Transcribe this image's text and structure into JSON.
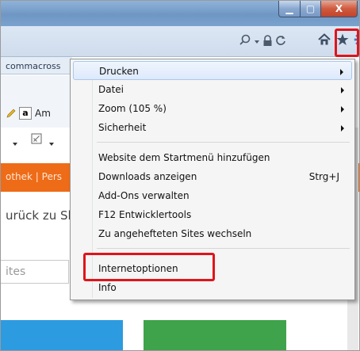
{
  "window": {
    "minimize_label": "▁",
    "maximize_label": "▢",
    "close_label": "X"
  },
  "toolbar": {
    "search_dropdown_icon": "search-icon",
    "lock_icon": "lock-icon",
    "refresh_icon": "refresh-icon",
    "home_icon": "home-icon",
    "favorites_icon": "star-icon",
    "tools_icon": "gear-icon"
  },
  "background": {
    "favorites_text": "commacross",
    "amazon_label": "Am",
    "orange_bar_text": "othek | Pers",
    "body_text": "urück zu Sl",
    "search_placeholder": "ites"
  },
  "menu": {
    "items": [
      {
        "label": "Drucken",
        "submenu": true,
        "accel": ""
      },
      {
        "label": "Datei",
        "submenu": true,
        "accel": ""
      },
      {
        "label": "Zoom (105 %)",
        "submenu": true,
        "accel": ""
      },
      {
        "label": "Sicherheit",
        "submenu": true,
        "accel": ""
      },
      {
        "label": "Website dem Startmenü hinzufügen",
        "submenu": false,
        "accel": ""
      },
      {
        "label": "Downloads anzeigen",
        "submenu": false,
        "accel": "Strg+J"
      },
      {
        "label": "Add-Ons verwalten",
        "submenu": false,
        "accel": ""
      },
      {
        "label": "F12 Entwicklertools",
        "submenu": false,
        "accel": ""
      },
      {
        "label": "Zu angehefteten Sites wechseln",
        "submenu": false,
        "accel": ""
      },
      {
        "label": "Internetoptionen",
        "submenu": false,
        "accel": ""
      },
      {
        "label": "Info",
        "submenu": false,
        "accel": ""
      }
    ]
  },
  "colors": {
    "highlight": "#e0141b",
    "orange_bar": "#ee6b18",
    "tile_blue": "#2d9be0",
    "tile_green": "#3ea34a"
  }
}
